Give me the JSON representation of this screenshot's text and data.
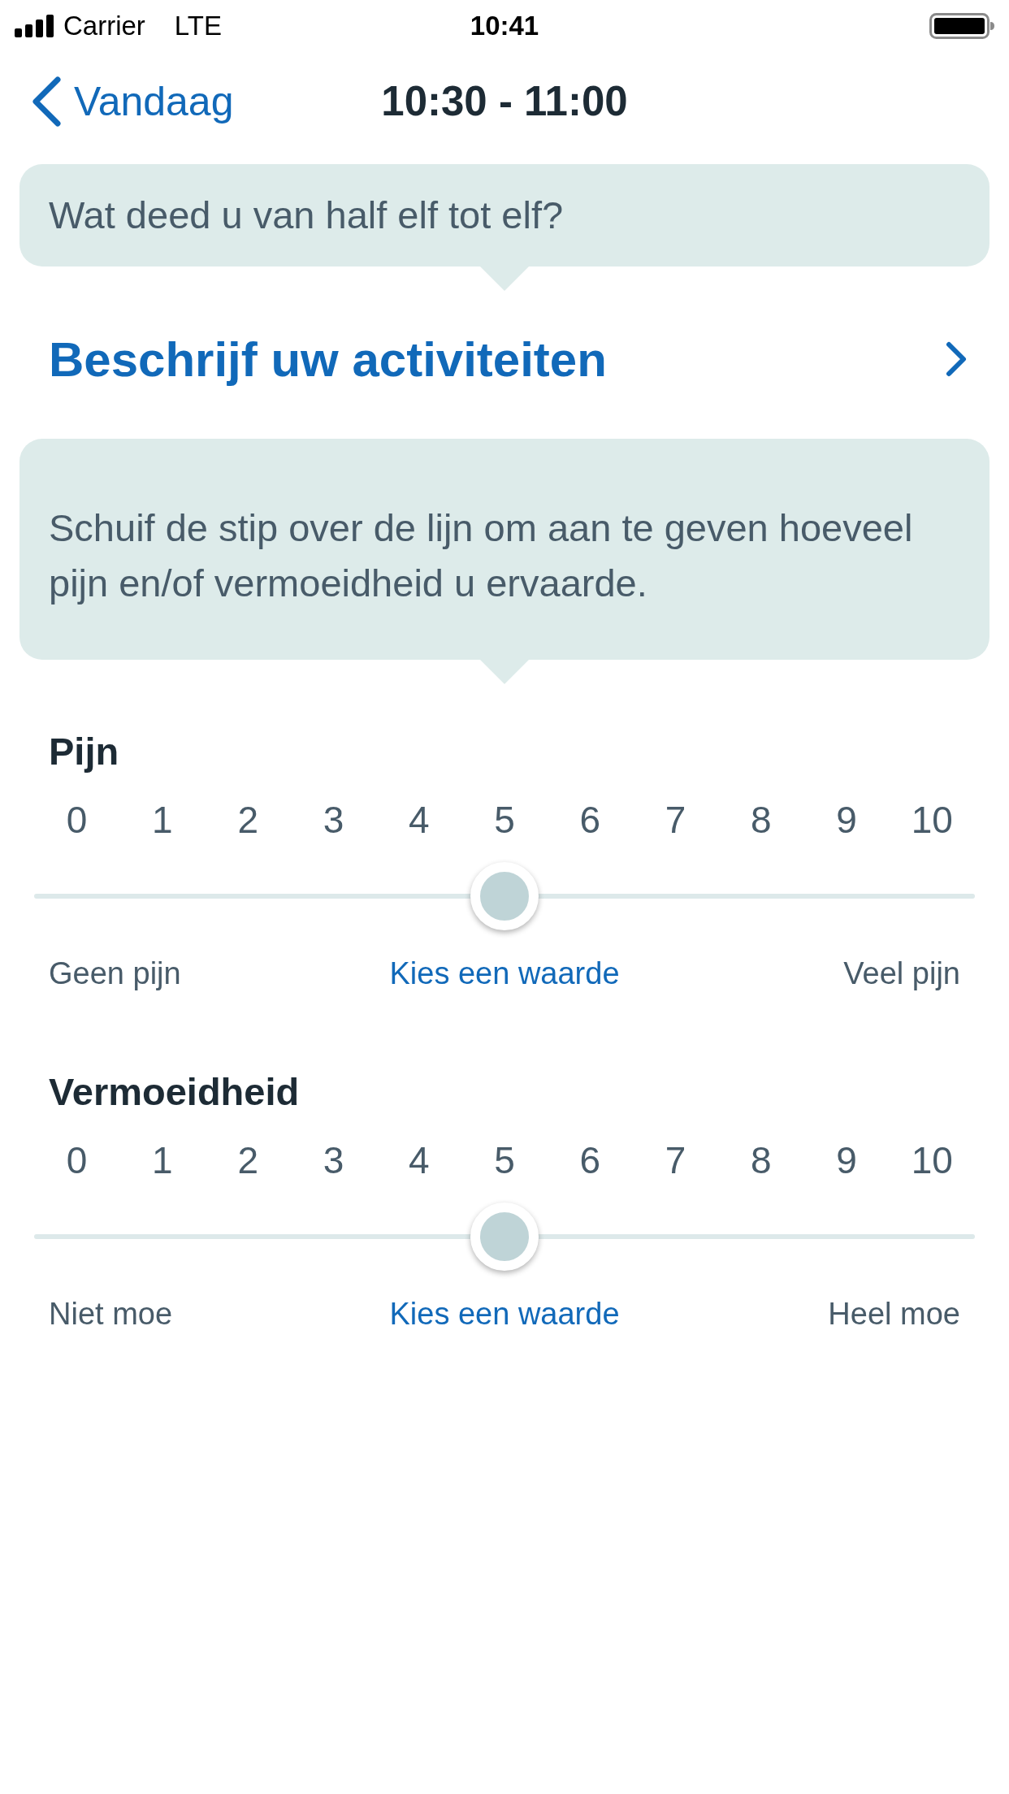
{
  "status_bar": {
    "carrier": "Carrier",
    "network": "LTE",
    "time": "10:41"
  },
  "nav_bar": {
    "back_label": "Vandaag",
    "title": "10:30 - 11:00"
  },
  "question_bubble": {
    "text": "Wat deed u van half elf tot elf?"
  },
  "activities_link": {
    "label": "Beschrijf uw activiteiten"
  },
  "instruction_bubble": {
    "text": "Schuif de stip over de lijn om aan te geven hoeveel pijn en/of vermoeidheid u ervaarde."
  },
  "sliders": [
    {
      "label": "Pijn",
      "ticks": [
        "0",
        "1",
        "2",
        "3",
        "4",
        "5",
        "6",
        "7",
        "8",
        "9",
        "10"
      ],
      "level": 0.5,
      "min_label": "Geen pijn",
      "value_prompt": "Kies een waarde",
      "max_label": "Veel pijn"
    },
    {
      "label": "Vermoeidheid",
      "ticks": [
        "0",
        "1",
        "2",
        "3",
        "4",
        "5",
        "6",
        "7",
        "8",
        "9",
        "10"
      ],
      "level": 0.5,
      "min_label": "Niet moe",
      "value_prompt": "Kies een waarde",
      "max_label": "Heel moe"
    }
  ]
}
